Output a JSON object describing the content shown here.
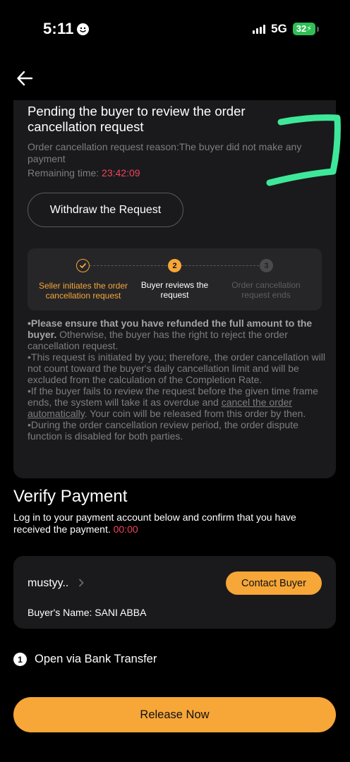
{
  "status_bar": {
    "time": "5:11",
    "network": "5G",
    "battery": "32"
  },
  "pending": {
    "title": "Pending the buyer to review the order cancellation request",
    "reason": "Order cancellation request reason:The buyer did not make any payment",
    "remaining_label": "Remaining time: ",
    "remaining_time": "23:42:09",
    "withdraw_label": "Withdraw the Request"
  },
  "steps": [
    {
      "number": "✓",
      "label": "Seller initiates the order cancellation request",
      "state": "done",
      "color": "#f7a638"
    },
    {
      "number": "2",
      "label": "Buyer reviews the request",
      "state": "current",
      "color": "#f7a638"
    },
    {
      "number": "3",
      "label": "Order cancellation request ends",
      "state": "pending",
      "color": "#4a4a4e"
    }
  ],
  "notes": {
    "n1_bold": "•Please ensure that you have refunded the full amount to the buyer.",
    "n1_rest": " Otherwise, the buyer has the right to reject the order cancellation request.",
    "n2": "•This request is initiated by you; therefore, the order cancellation will not count toward the buyer's daily cancellation limit and will be excluded from the calculation of the Completion Rate.",
    "n3_a": "•If the buyer fails to review the request before the given time frame ends, the system will take it as overdue and ",
    "n3_link": "cancel the order automatically",
    "n3_b": ". Your coin will be released from this order by then.",
    "n4": "•During the order cancellation review period, the order dispute function is disabled for both parties."
  },
  "verify": {
    "title": "Verify Payment",
    "description": "Log in to your payment account below and confirm that you have received the payment. ",
    "timer": "00:00"
  },
  "buyer": {
    "nickname": "mustyy..",
    "contact_label": "Contact Buyer",
    "name_label": "Buyer's Name: SANI ABBA"
  },
  "payment_method": {
    "number": "1",
    "label": "Open via Bank Transfer"
  },
  "release_label": "Release Now",
  "colors": {
    "accent": "#f7a638",
    "danger": "#f0455a",
    "annotation": "#3ee89a"
  }
}
